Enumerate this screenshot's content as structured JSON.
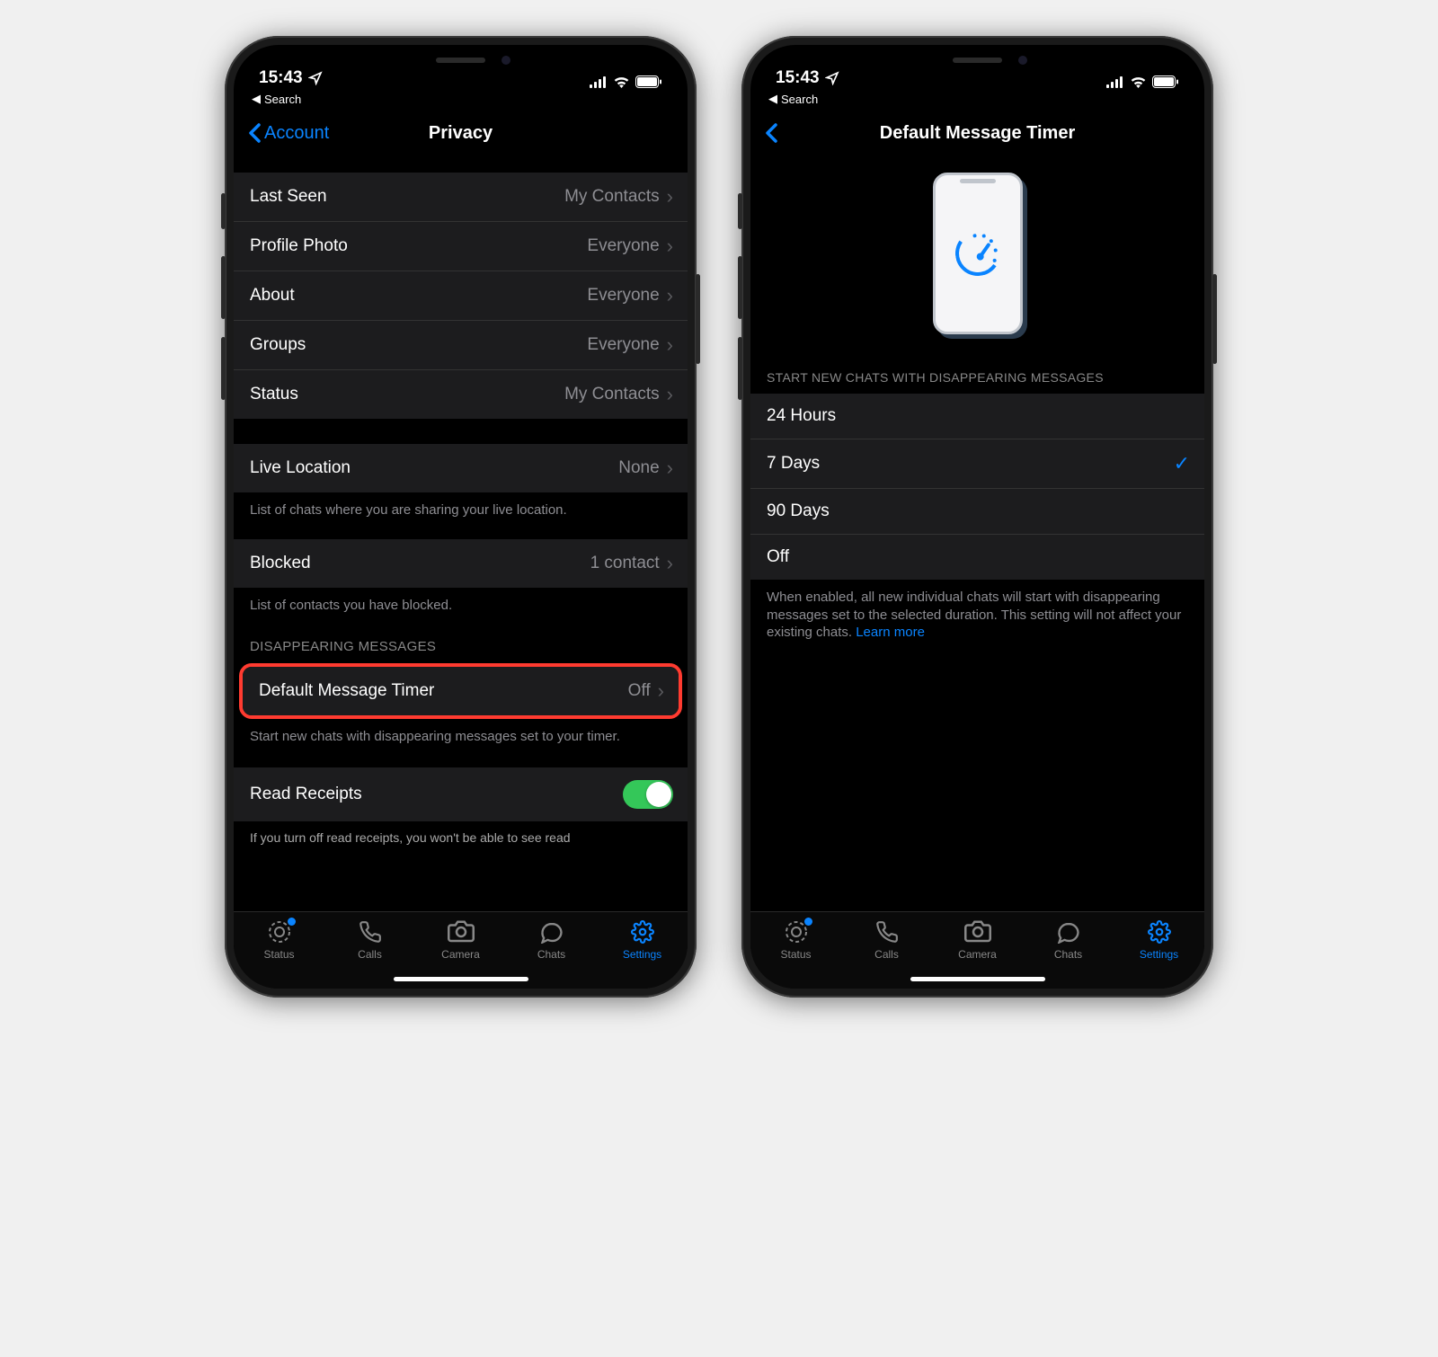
{
  "statusBar": {
    "time": "15:43",
    "backApp": "Search"
  },
  "left": {
    "nav": {
      "back": "Account",
      "title": "Privacy"
    },
    "rows": {
      "lastSeen": {
        "label": "Last Seen",
        "value": "My Contacts"
      },
      "profilePhoto": {
        "label": "Profile Photo",
        "value": "Everyone"
      },
      "about": {
        "label": "About",
        "value": "Everyone"
      },
      "groups": {
        "label": "Groups",
        "value": "Everyone"
      },
      "status": {
        "label": "Status",
        "value": "My Contacts"
      },
      "liveLocation": {
        "label": "Live Location",
        "value": "None"
      },
      "liveLocationFooter": "List of chats where you are sharing your live location.",
      "blocked": {
        "label": "Blocked",
        "value": "1 contact"
      },
      "blockedFooter": "List of contacts you have blocked.",
      "disappearingHeader": "DISAPPEARING MESSAGES",
      "defaultTimer": {
        "label": "Default Message Timer",
        "value": "Off"
      },
      "defaultTimerFooter": "Start new chats with disappearing messages set to your timer.",
      "readReceipts": {
        "label": "Read Receipts"
      },
      "readReceiptsCutoff": "If you turn off read receipts, you won't be able to see read"
    }
  },
  "right": {
    "nav": {
      "title": "Default Message Timer"
    },
    "header": "START NEW CHATS WITH DISAPPEARING MESSAGES",
    "options": {
      "opt1": "24 Hours",
      "opt2": "7 Days",
      "opt3": "90 Days",
      "opt4": "Off"
    },
    "footer": "When enabled, all new individual chats will start with disappearing messages set to the selected duration. This setting will not affect your existing chats. ",
    "learnMore": "Learn more"
  },
  "tabs": {
    "status": "Status",
    "calls": "Calls",
    "camera": "Camera",
    "chats": "Chats",
    "settings": "Settings"
  }
}
